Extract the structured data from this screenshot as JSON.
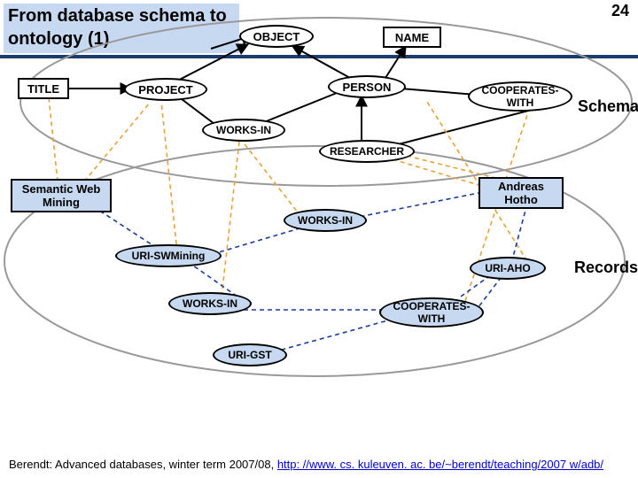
{
  "header": {
    "title": "From database schema to ontology (1)",
    "page_number": "24"
  },
  "side_labels": {
    "schema": "Schema",
    "records": "Records"
  },
  "nodes": {
    "object": "OBJECT",
    "name": "NAME",
    "title": "TITLE",
    "project": "PROJECT",
    "person": "PERSON",
    "cooperates_with_1": "COOPERATES-WITH",
    "works_in_1": "WORKS-IN",
    "researcher": "RESEARCHER",
    "semantic_web_mining": "Semantic Web Mining",
    "andreas_hotho": "Andreas Hotho",
    "works_in_2": "WORKS-IN",
    "uri_swmining": "URI-SWMining",
    "uri_aho": "URI-AHO",
    "works_in_3": "WORKS-IN",
    "cooperates_with_2": "COOPERATES-WITH",
    "uri_gst": "URI-GST"
  },
  "footer": {
    "text_prefix": "Berendt: Advanced databases, winter term 2007/08, ",
    "link": "http: //www. cs. kuleuven. ac. be/~berendt/teaching/2007 w/adb/"
  }
}
